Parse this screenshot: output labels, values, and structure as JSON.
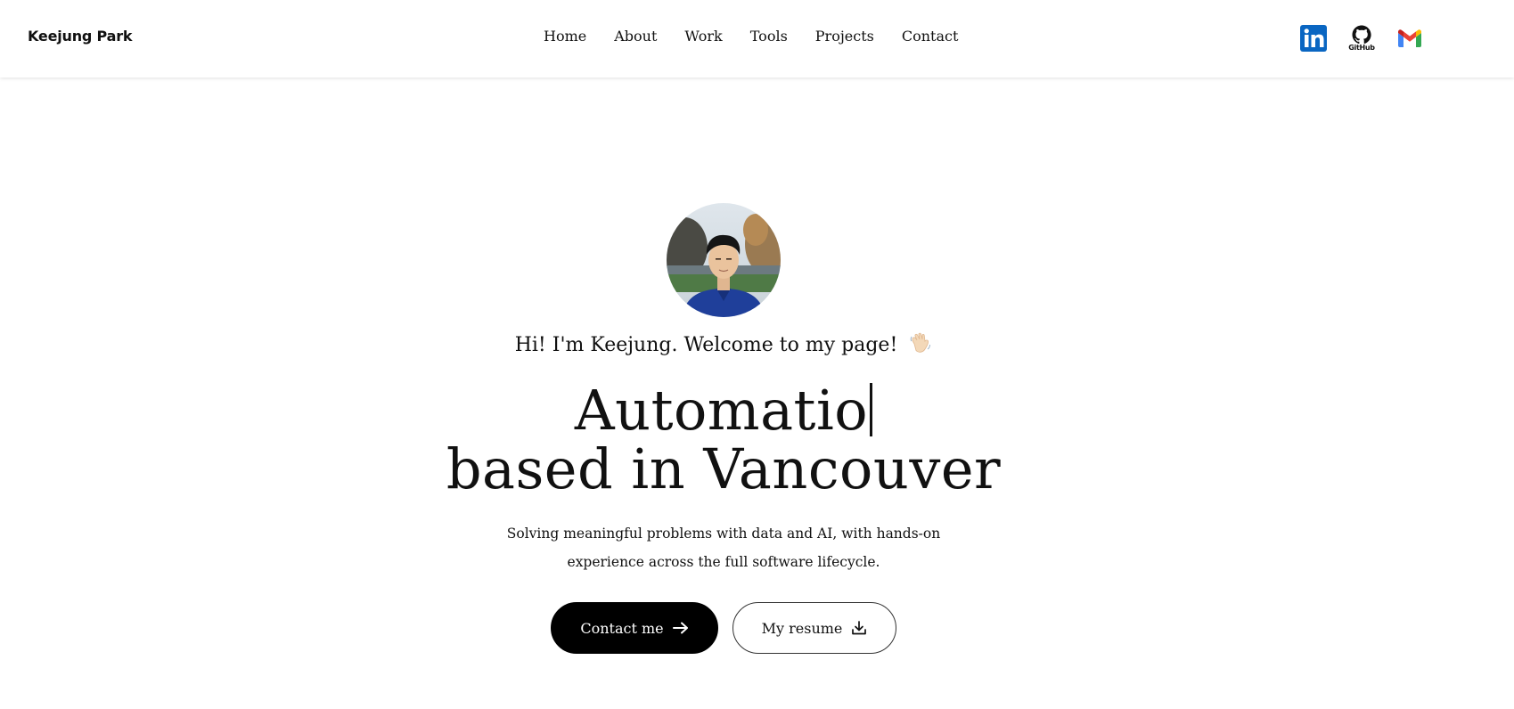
{
  "header": {
    "brand": "Keejung Park",
    "nav": [
      {
        "label": "Home"
      },
      {
        "label": "About"
      },
      {
        "label": "Work"
      },
      {
        "label": "Tools"
      },
      {
        "label": "Projects"
      },
      {
        "label": "Contact"
      }
    ],
    "socials": {
      "linkedin_icon": "linkedin-icon",
      "github_label": "GitHub",
      "gmail_icon": "gmail-icon"
    }
  },
  "hero": {
    "greeting": "Hi! I'm Keejung. Welcome to my page!",
    "greeting_emoji": "waving-hand",
    "headline_typed": "Automatio",
    "headline_line2": "based in Vancouver",
    "subtext_line1": "Solving meaningful problems with data and AI, with hands-on",
    "subtext_line2": "experience across the full software lifecycle.",
    "contact_button": "Contact me",
    "resume_button": "My resume"
  },
  "colors": {
    "linkedin_blue": "#0a66c2",
    "button_black": "#000000",
    "text": "#111111"
  }
}
